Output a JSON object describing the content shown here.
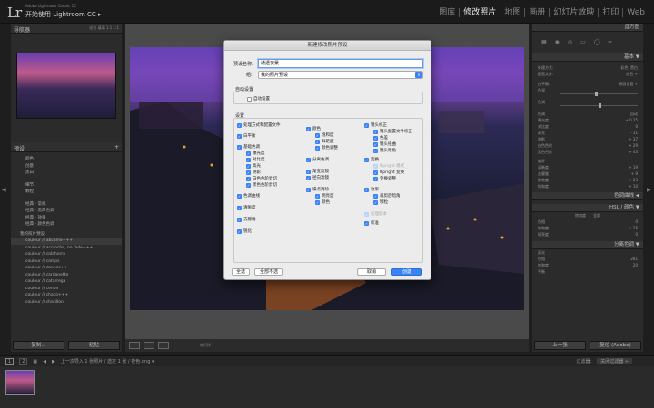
{
  "app": {
    "logo": "Lr",
    "subtitle": "Adobe Lightroom Classic CC",
    "title": "开始使用 Lightroom CC ▸"
  },
  "modules": [
    "图库",
    "修改照片",
    "地图",
    "画册",
    "幻灯片放映",
    "打印",
    "Web"
  ],
  "left_panel": {
    "navigator_title": "导航器",
    "navigator_options": "适合   填满   1:1   1:1",
    "presets_title": "预设",
    "preset_groups": [
      "颜色",
      "创意",
      "黑白",
      "细节",
      "颗粒",
      "经典 - 常规",
      "经典 - 黑白色调",
      "经典 - 效果",
      "经典 - 颜色色调"
    ],
    "my_presets_title": "我的照片预设",
    "my_presets": [
      "couleur // abcame+++",
      "couleur // accroche, no fade+++",
      "couleur // calahorra",
      "couleur // camps",
      "couleur // cannes++",
      "couleur // cardanette",
      "couleur // catarrega",
      "couleur // cenon",
      "couleur // chaco+++",
      "couleur // chatillon"
    ],
    "copy_button": "复制...",
    "paste_button": "粘贴"
  },
  "dialog": {
    "title": "新建修改照片预设",
    "name_label": "预设名称:",
    "name_value": "通透夜景",
    "group_label": "组:",
    "group_value": "我的照片预设",
    "auto_settings_title": "自动设置",
    "auto_settings_label": "自动设置",
    "settings_title": "设置",
    "col1": [
      "处理方式和配置文件",
      "白平衡",
      "基础色调",
      "曝光度",
      "对比度",
      "高光",
      "阴影",
      "白色色阶剪切",
      "黑色色阶剪切",
      "色调曲线",
      "清晰度",
      "去朦胧",
      "锐化"
    ],
    "col2": [
      "颜色",
      "饱和度",
      "鲜艳度",
      "颜色调整",
      "分离色调",
      "渐变滤镜",
      "径向滤镜",
      "噪点消除",
      "明亮度",
      "颜色"
    ],
    "col3": [
      "镜头校正",
      "镜头配置文件校正",
      "色差",
      "镜头扭曲",
      "镜头暗角",
      "变换",
      "Upright 模式",
      "Upright 变换",
      "变换调整",
      "效果",
      "裁剪后暗角",
      "颗粒",
      "处理版本",
      "校准"
    ],
    "check_all": "全选",
    "check_none": "全部不选",
    "cancel": "取消",
    "create": "创建"
  },
  "right_panel": {
    "histogram_title": "直方图",
    "basic_title": "基本 ▼",
    "treatment_label": "处理方式:",
    "treatment_color": "彩色",
    "treatment_bw": "黑白",
    "profile_label": "配置文件:",
    "profile_value": "颜色 ÷",
    "wb_label": "白平衡:",
    "wb_value": "原照设置 ÷",
    "temp_label": "色温",
    "tint_label": "色调",
    "tone_label": "色调",
    "auto_label": "自动",
    "exposure": {
      "label": "曝光度",
      "value": "+ 0.25"
    },
    "contrast": {
      "label": "对比度",
      "value": "0"
    },
    "highlights": {
      "label": "高光",
      "value": "- 31"
    },
    "shadows": {
      "label": "阴影",
      "value": "+ 37"
    },
    "whites": {
      "label": "白色色阶",
      "value": "+ 29"
    },
    "blacks": {
      "label": "黑色色阶",
      "value": "+ 43"
    },
    "presence_label": "偏好",
    "texture": {
      "label": "清晰度",
      "value": "+ 19"
    },
    "dehaze": {
      "label": "去朦胧",
      "value": "+ 9"
    },
    "vibrance": {
      "label": "鲜艳度",
      "value": "+ 23"
    },
    "saturation": {
      "label": "饱和度",
      "value": "+ 10"
    },
    "tone_curve_title": "色调曲线 ◀",
    "hsl_title": "HSL / 颜色 ▼",
    "hsl_tab_all": "全部",
    "hsl_tab": "饱和度",
    "hsl_hue": "色相",
    "hsl_hue_val": "0",
    "hsl_sat": "饱和度",
    "hsl_sat_val": "+ 76",
    "hsl_lum": "明亮度",
    "hsl_lum_val": "0",
    "split_title": "分离色调 ▼",
    "highlights_sub": "高光",
    "split_hue": "色相",
    "split_hue_val": "281",
    "split_sat": "饱和度",
    "split_sat_val": "20",
    "balance": "平衡",
    "prev_button": "上一张",
    "reset_button": "复位 (Adobe)"
  },
  "toolbar": {
    "softproof": "软打样"
  },
  "filmstrip": {
    "page1": "1",
    "page2": "2",
    "path": "上一次导入   1 张照片 / 选定 1 张 / 夜色.dng ▾",
    "filter_label": "过滤器:",
    "filter_value": "关闭过滤器 ÷"
  }
}
